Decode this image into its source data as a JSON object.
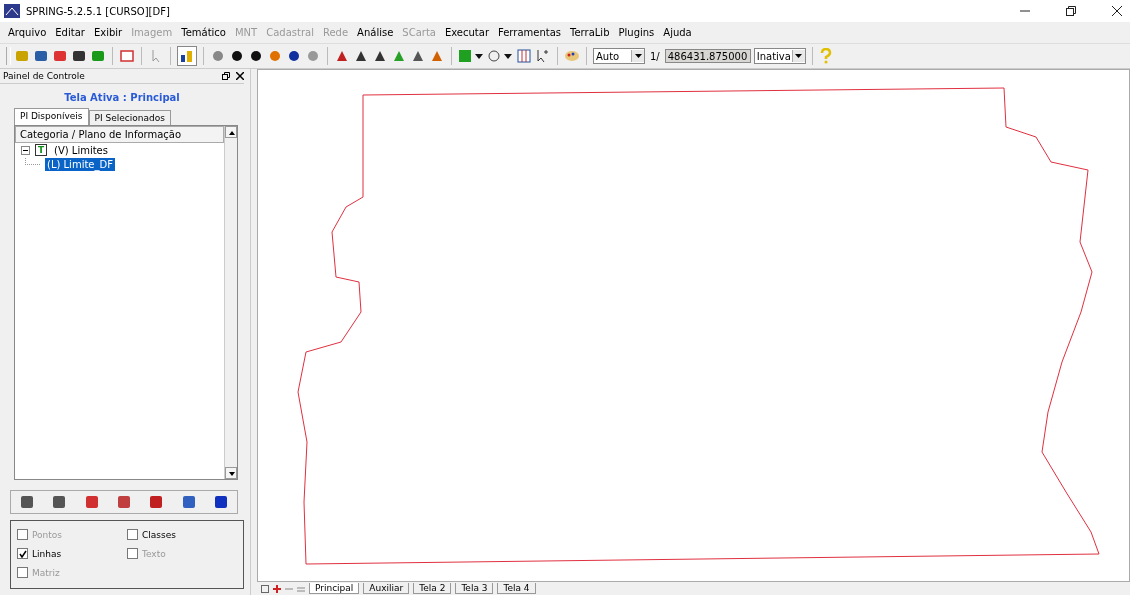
{
  "window": {
    "title": "SPRING-5.2.5.1 [CURSO][DF]"
  },
  "menu": [
    {
      "label": "Arquivo",
      "disabled": false
    },
    {
      "label": "Editar",
      "disabled": false
    },
    {
      "label": "Exibir",
      "disabled": false
    },
    {
      "label": "Imagem",
      "disabled": true
    },
    {
      "label": "Temático",
      "disabled": false
    },
    {
      "label": "MNT",
      "disabled": true
    },
    {
      "label": "Cadastral",
      "disabled": true
    },
    {
      "label": "Rede",
      "disabled": true
    },
    {
      "label": "Análise",
      "disabled": false
    },
    {
      "label": "SCarta",
      "disabled": true
    },
    {
      "label": "Executar",
      "disabled": false
    },
    {
      "label": "Ferramentas",
      "disabled": false
    },
    {
      "label": "TerraLib",
      "disabled": false
    },
    {
      "label": "Plugins",
      "disabled": false
    },
    {
      "label": "Ajuda",
      "disabled": false
    }
  ],
  "toolbar": {
    "zoom_mode": "Auto",
    "scale_prefix": "1/",
    "scale": "486431.875000",
    "cursor_mode": "Inativa"
  },
  "panel": {
    "title": "Painel de Controle",
    "active_screen": "Tela Ativa : Principal",
    "tabs": [
      {
        "label": "PI Disponíveis",
        "selected": true
      },
      {
        "label": "PI Selecionados",
        "selected": false
      }
    ],
    "tree_header": "Categoria / Plano de Informação",
    "tree": [
      {
        "badge": "T",
        "label": "(V) Limites",
        "expanded": true,
        "selected": false,
        "children": [
          {
            "label": "(L) Limite_DF",
            "selected": true
          }
        ]
      }
    ],
    "options": [
      {
        "label": "Pontos",
        "checked": false,
        "disabled": true
      },
      {
        "label": "Classes",
        "checked": false,
        "disabled": false
      },
      {
        "label": "Linhas",
        "checked": true,
        "disabled": false
      },
      {
        "label": "Texto",
        "checked": false,
        "disabled": true
      },
      {
        "label": "Matriz",
        "checked": false,
        "disabled": true
      }
    ]
  },
  "screen_tabs": [
    {
      "label": "Principal",
      "selected": true
    },
    {
      "label": "Auxiliar",
      "selected": false
    },
    {
      "label": "Tela 2",
      "selected": false
    },
    {
      "label": "Tela 3",
      "selected": false
    },
    {
      "label": "Tela 4",
      "selected": false
    }
  ]
}
